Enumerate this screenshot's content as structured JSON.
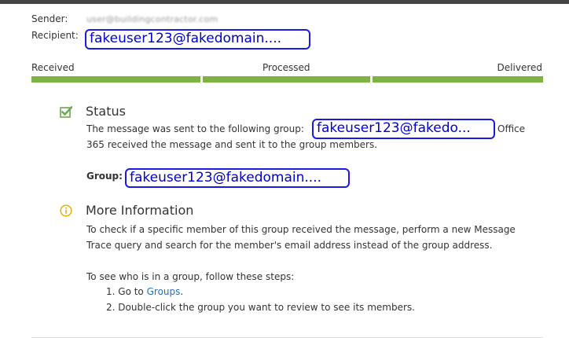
{
  "sender": {
    "label": "Sender:",
    "value_blurred": "user@buildingcontractor.com"
  },
  "recipient": {
    "label": "Recipient:",
    "value": "fakeuser123@fakedomain...."
  },
  "progress": {
    "stages": [
      "Received",
      "Processed",
      "Delivered"
    ]
  },
  "status": {
    "icon": "checkbox-checked-icon",
    "title": "Status",
    "line1_prefix": "The message was sent to the following group:",
    "group_email": "fakeuser123@fakedo...",
    "line1_suffix": "Office",
    "line2": "365 received the message and sent it to the group members.",
    "group_label": "Group:",
    "group_value": "fakeuser123@fakedomain...."
  },
  "more_info": {
    "icon": "info-icon",
    "title": "More Information",
    "paragraph": "To check if a specific member of this group received the message, perform a new Message Trace query and search for the member's email address instead of the group address.",
    "steps_intro": "To see who is in a group, follow these steps:",
    "step1_prefix": "1. Go to ",
    "step1_link": "Groups",
    "step1_suffix": ".",
    "step2": "2. Double-click the group you want to review to see its members."
  },
  "colors": {
    "progress_green": "#7cb342",
    "redaction_blue": "#1a1ae6",
    "link_blue": "#2a6ebb",
    "info_yellow": "#e8b10d"
  }
}
